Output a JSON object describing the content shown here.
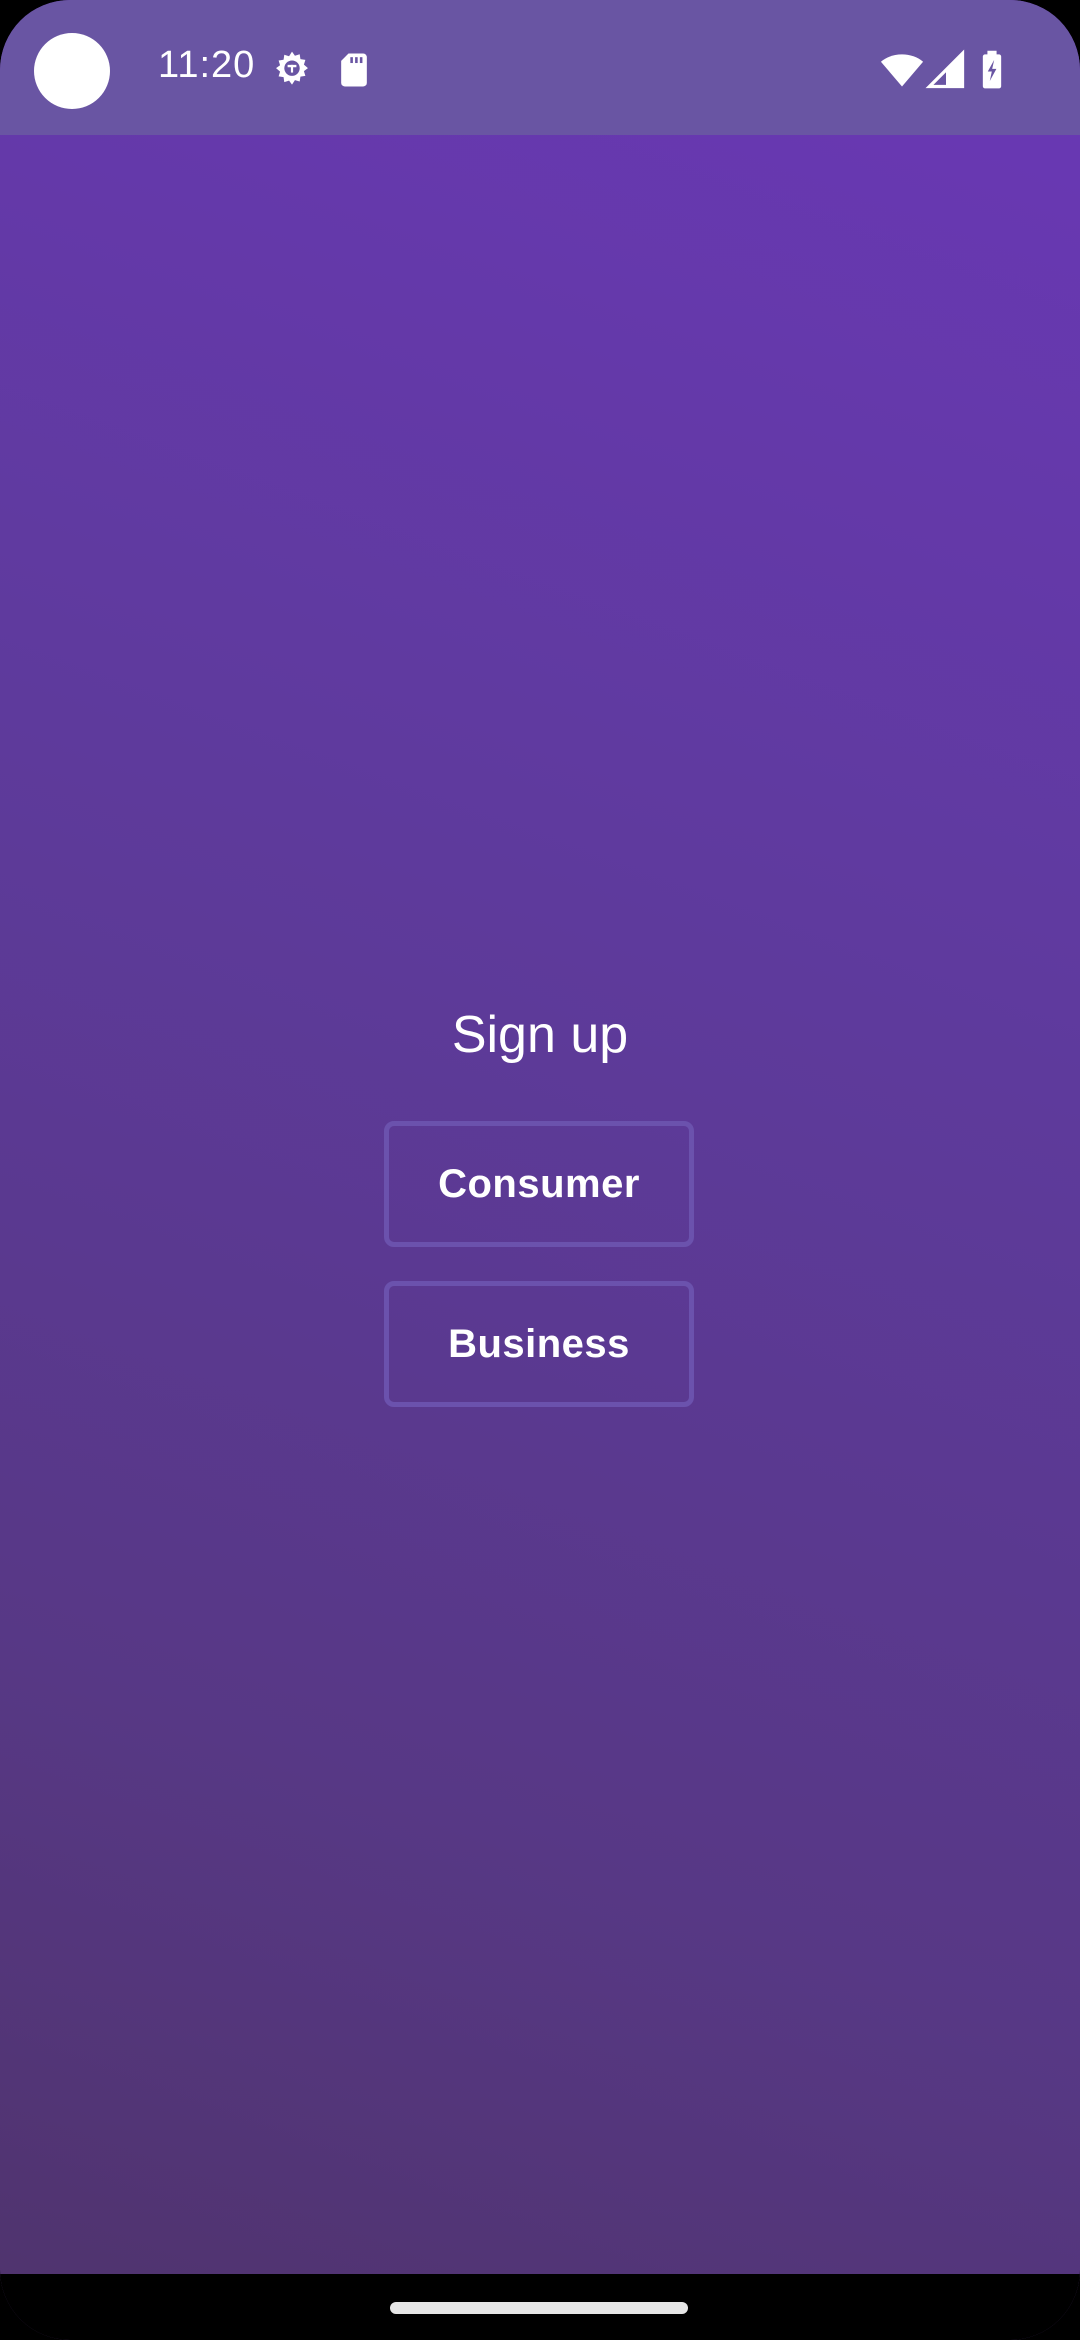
{
  "status_bar": {
    "time": "11:20",
    "icons": [
      "settings-gear-icon",
      "sd-card-icon",
      "wifi-icon",
      "cellular-signal-icon",
      "battery-charging-icon"
    ]
  },
  "main": {
    "title": "Sign up",
    "buttons": {
      "consumer_label": "Consumer",
      "business_label": "Business"
    }
  },
  "colors": {
    "background_top": "#6a38b6",
    "background_bottom": "#4f336c",
    "status_bar": "#6955a3",
    "button_border": "#6b52ad",
    "text": "#ffffff"
  }
}
